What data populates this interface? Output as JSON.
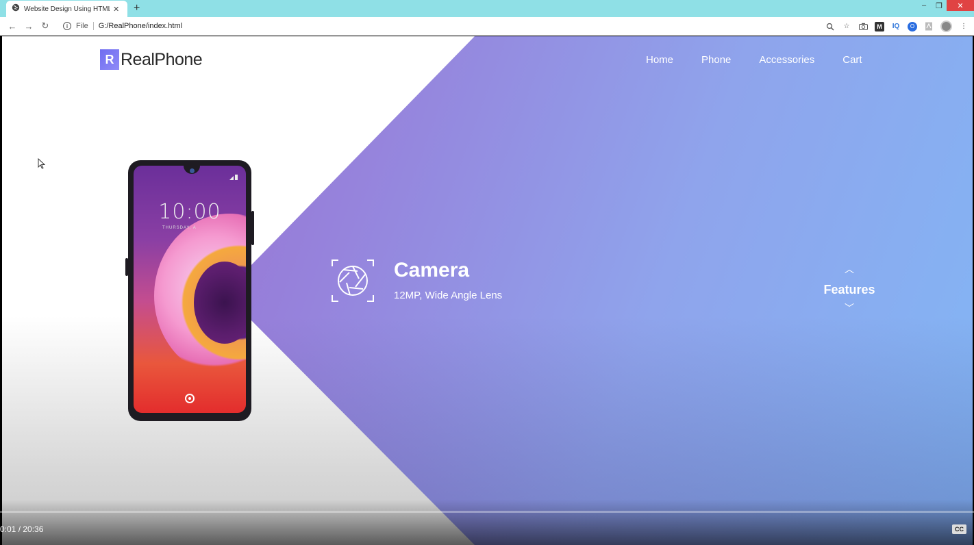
{
  "browser": {
    "tab_title": "Website Design Using HTML An",
    "tab_close": "✕",
    "new_tab": "+",
    "url_scheme_label": "File",
    "url": "G:/RealPhone/index.html",
    "window": {
      "minimize": "–",
      "restore": "❐",
      "close": "✕"
    },
    "nav": {
      "back": "←",
      "forward": "→",
      "reload": "↻"
    },
    "info_glyph": "i",
    "extensions": {
      "zoom": "🔍",
      "bookmark": "☆",
      "camera": "📷",
      "m": "M",
      "iq": "IQ",
      "o": "O",
      "menu": "⋮"
    }
  },
  "site": {
    "logo_mark": "R",
    "logo_text": "RealPhone",
    "nav": [
      "Home",
      "Phone",
      "Accessories",
      "Cart"
    ],
    "phone": {
      "time": "10:00",
      "date": "THURSDAY, A"
    },
    "feature": {
      "title": "Camera",
      "subtitle": "12MP, Wide Angle Lens"
    },
    "features_label": "Features",
    "chev_up": "︿",
    "chev_down": "﹀"
  },
  "player": {
    "time": "0:01 / 20:36",
    "cc_label": "CC"
  },
  "colors": {
    "accent_gradient_start": "#9b62c8",
    "accent_gradient_end": "#82b6f5",
    "titlebar": "#8fe0e6"
  }
}
